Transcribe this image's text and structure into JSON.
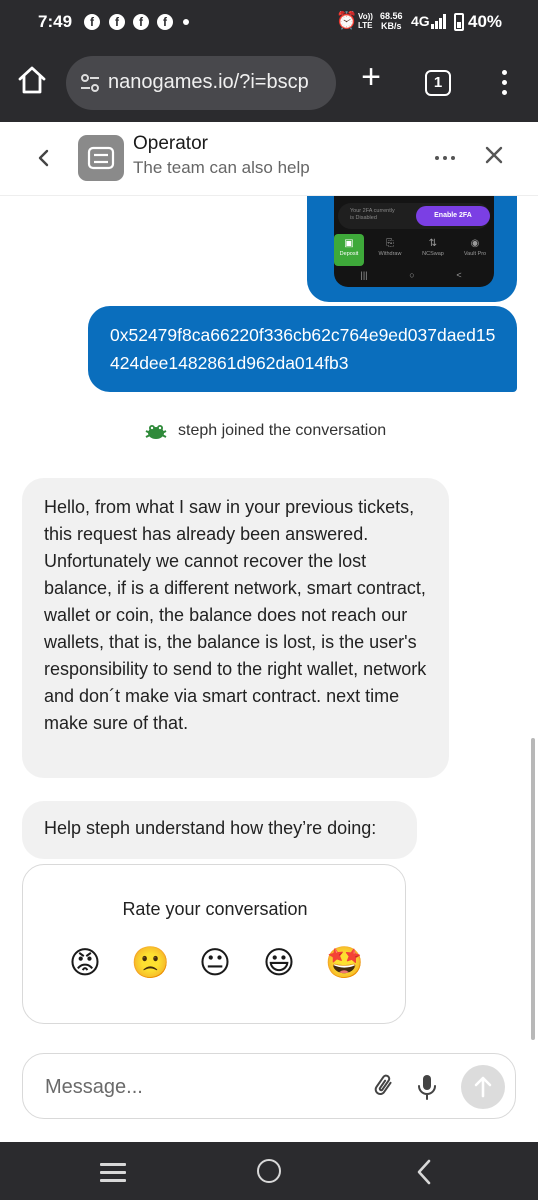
{
  "status_bar": {
    "time": "7:49",
    "notif_icon": "f",
    "volte_line1": "Vo))",
    "volte_line2": "LTE",
    "speed_value": "68.56",
    "speed_unit": "KB/s",
    "network": "4G",
    "battery_pct": "40%",
    "battery_level": 0.4
  },
  "browser": {
    "url": "nanogames.io/?i=bscp",
    "plus": "+",
    "tab_count": "1"
  },
  "chat_header": {
    "title": "Operator",
    "subtitle": "The team can also help"
  },
  "shared_screenshot": {
    "twofa_note": "Your 2FA currently is Disabled",
    "enable_label": "Enable 2FA",
    "actions": [
      {
        "label": "Deposit",
        "icon": "wallet-icon"
      },
      {
        "label": "Withdraw",
        "icon": "withdraw-icon"
      },
      {
        "label": "NCSwap",
        "icon": "swap-icon"
      },
      {
        "label": "Vault Pro",
        "icon": "vault-icon"
      }
    ],
    "nav_glyphs": [
      "|||",
      "○",
      "<"
    ]
  },
  "messages": {
    "user_address": "0x52479f8ca66220f336cb62c764e9ed037daed15424dee1482861d962da014fb3",
    "joined_text": "steph joined the conversation",
    "agent_reply": "Hello, from what I saw in your previous tickets, this request has already been answered. Unfortunately we cannot recover the lost balance, if is a different network, smart contract, wallet or coin, the balance does not reach our wallets, that is, the balance is lost, is the user's responsibility to send to the right wallet, network and don´t make via smart contract. next time make sure of that.",
    "rating_prompt": "Help steph understand how they’re doing:"
  },
  "rating": {
    "title": "Rate your conversation",
    "options": [
      "😡",
      "🙁",
      "😐",
      "😃",
      "🤩"
    ]
  },
  "composer": {
    "placeholder": "Message..."
  },
  "colors": {
    "user_bubble": "#0a6ebd",
    "agent_bubble": "#f1f1f1",
    "chrome_dark": "#2b2b2e",
    "deposit_green": "#3ea93a",
    "enable_purple": "#7b3fe4"
  }
}
